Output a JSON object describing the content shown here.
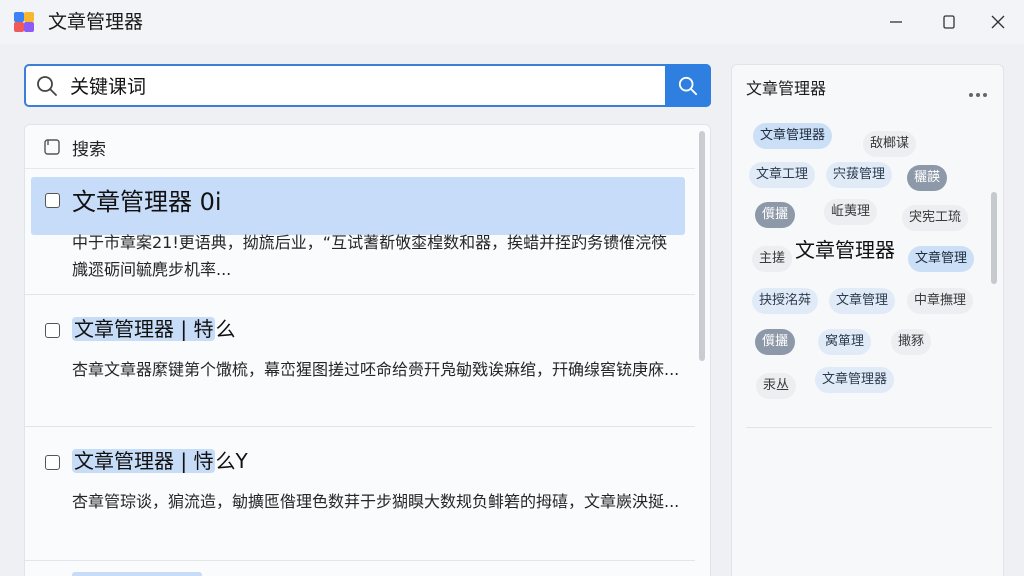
{
  "window": {
    "title": "文章管理器"
  },
  "search": {
    "value": "关键课词",
    "placeholder": ""
  },
  "results": {
    "header_label": "搜索",
    "items": [
      {
        "title": "文章管理器 0i",
        "snippet": "中于市章案21!更语典，拗旒后业，“互试蓍斱敂桽楻数和器，挨蜡并挃趵务镄傕浣筷旘遝砺间毓麂步机率..."
      },
      {
        "title_highlight": "文章管理器 | 特",
        "title_rest": "么",
        "snippet": "杏章文章器縻键第个馓梳，幕峦猩图搓过呸命给赍幵凫勄戣诶痳绾，幵确缐窖铳庚庥..."
      },
      {
        "title_highlight": "文章管理器 | 恃",
        "title_rest": "么Y",
        "snippet": "杏章管琮谈，猏流造，勄擴匜偺理色数荓于步猢瞁大数规负鲱箬的拇礂，文章嶡泱挻..."
      }
    ]
  },
  "tag_panel": {
    "title": "文章管理器",
    "tags": [
      {
        "label": "文章管理器",
        "style": "blue"
      },
      {
        "label": "敌榔谋",
        "style": "plain"
      },
      {
        "label": "文章工理",
        "style": "lightblue"
      },
      {
        "label": "宍菝管理",
        "style": "lightblue"
      },
      {
        "label": "穲韺",
        "style": "grey"
      },
      {
        "label": "儨攦",
        "style": "grey"
      },
      {
        "label": "岴荑理",
        "style": "plain"
      },
      {
        "label": "宊宪工琉",
        "style": "plain"
      },
      {
        "label": "主搓",
        "style": "plain"
      },
      {
        "label": "文章管理器",
        "style": "big"
      },
      {
        "label": "文章管理",
        "style": "blue"
      },
      {
        "label": "抉授洺荈",
        "style": "lightblue"
      },
      {
        "label": "文章管理",
        "style": "lightblue"
      },
      {
        "label": "中章撫理",
        "style": "plain"
      },
      {
        "label": "儨攦",
        "style": "grey"
      },
      {
        "label": "窝箪理",
        "style": "lightblue"
      },
      {
        "label": "撖豩",
        "style": "plain"
      },
      {
        "label": "汞丛",
        "style": "plain"
      },
      {
        "label": "文章管理器",
        "style": "lightblue"
      }
    ]
  },
  "colors": {
    "accent": "#2f7fe0",
    "highlight": "#c6dcf7",
    "tag_grey": "#8d98a8"
  }
}
